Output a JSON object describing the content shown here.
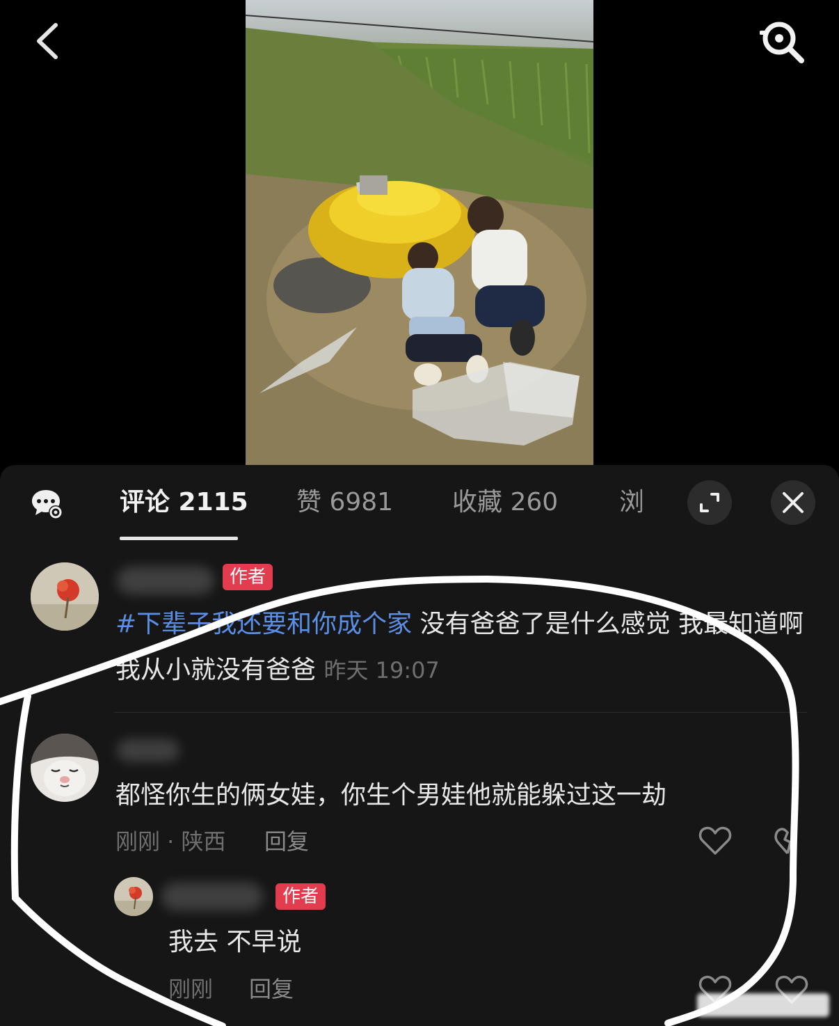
{
  "tabs": {
    "comments": "评论 2115",
    "likes": "赞 6981",
    "favorites": "收藏 260",
    "views_partial": "浏"
  },
  "comments": [
    {
      "badge": "作者",
      "tag_text": "#下辈子我还要和你成个家",
      "text": " 没有爸爸了是什么感觉 我最知道啊 我从小就没有爸爸 ",
      "time": "昨天 19:07"
    },
    {
      "text": "都怪你生的俩女娃，你生个男娃他就能躲过这一劫",
      "meta": "刚刚 · 陕西",
      "reply_label": "回复",
      "reply": {
        "badge": "作者",
        "text": "我去 不早说",
        "meta": "刚刚",
        "reply_label": "回复"
      }
    }
  ],
  "colors": {
    "panel_bg": "#161616",
    "tag_blue": "#5b8fe6",
    "author_badge": "#e33c4f",
    "annotation_stroke": "#ffffff"
  },
  "icons": [
    "back-arrow-icon",
    "search-icon",
    "chat-settings-icon",
    "expand-icon",
    "close-icon",
    "heart-icon",
    "dislike-icon"
  ]
}
